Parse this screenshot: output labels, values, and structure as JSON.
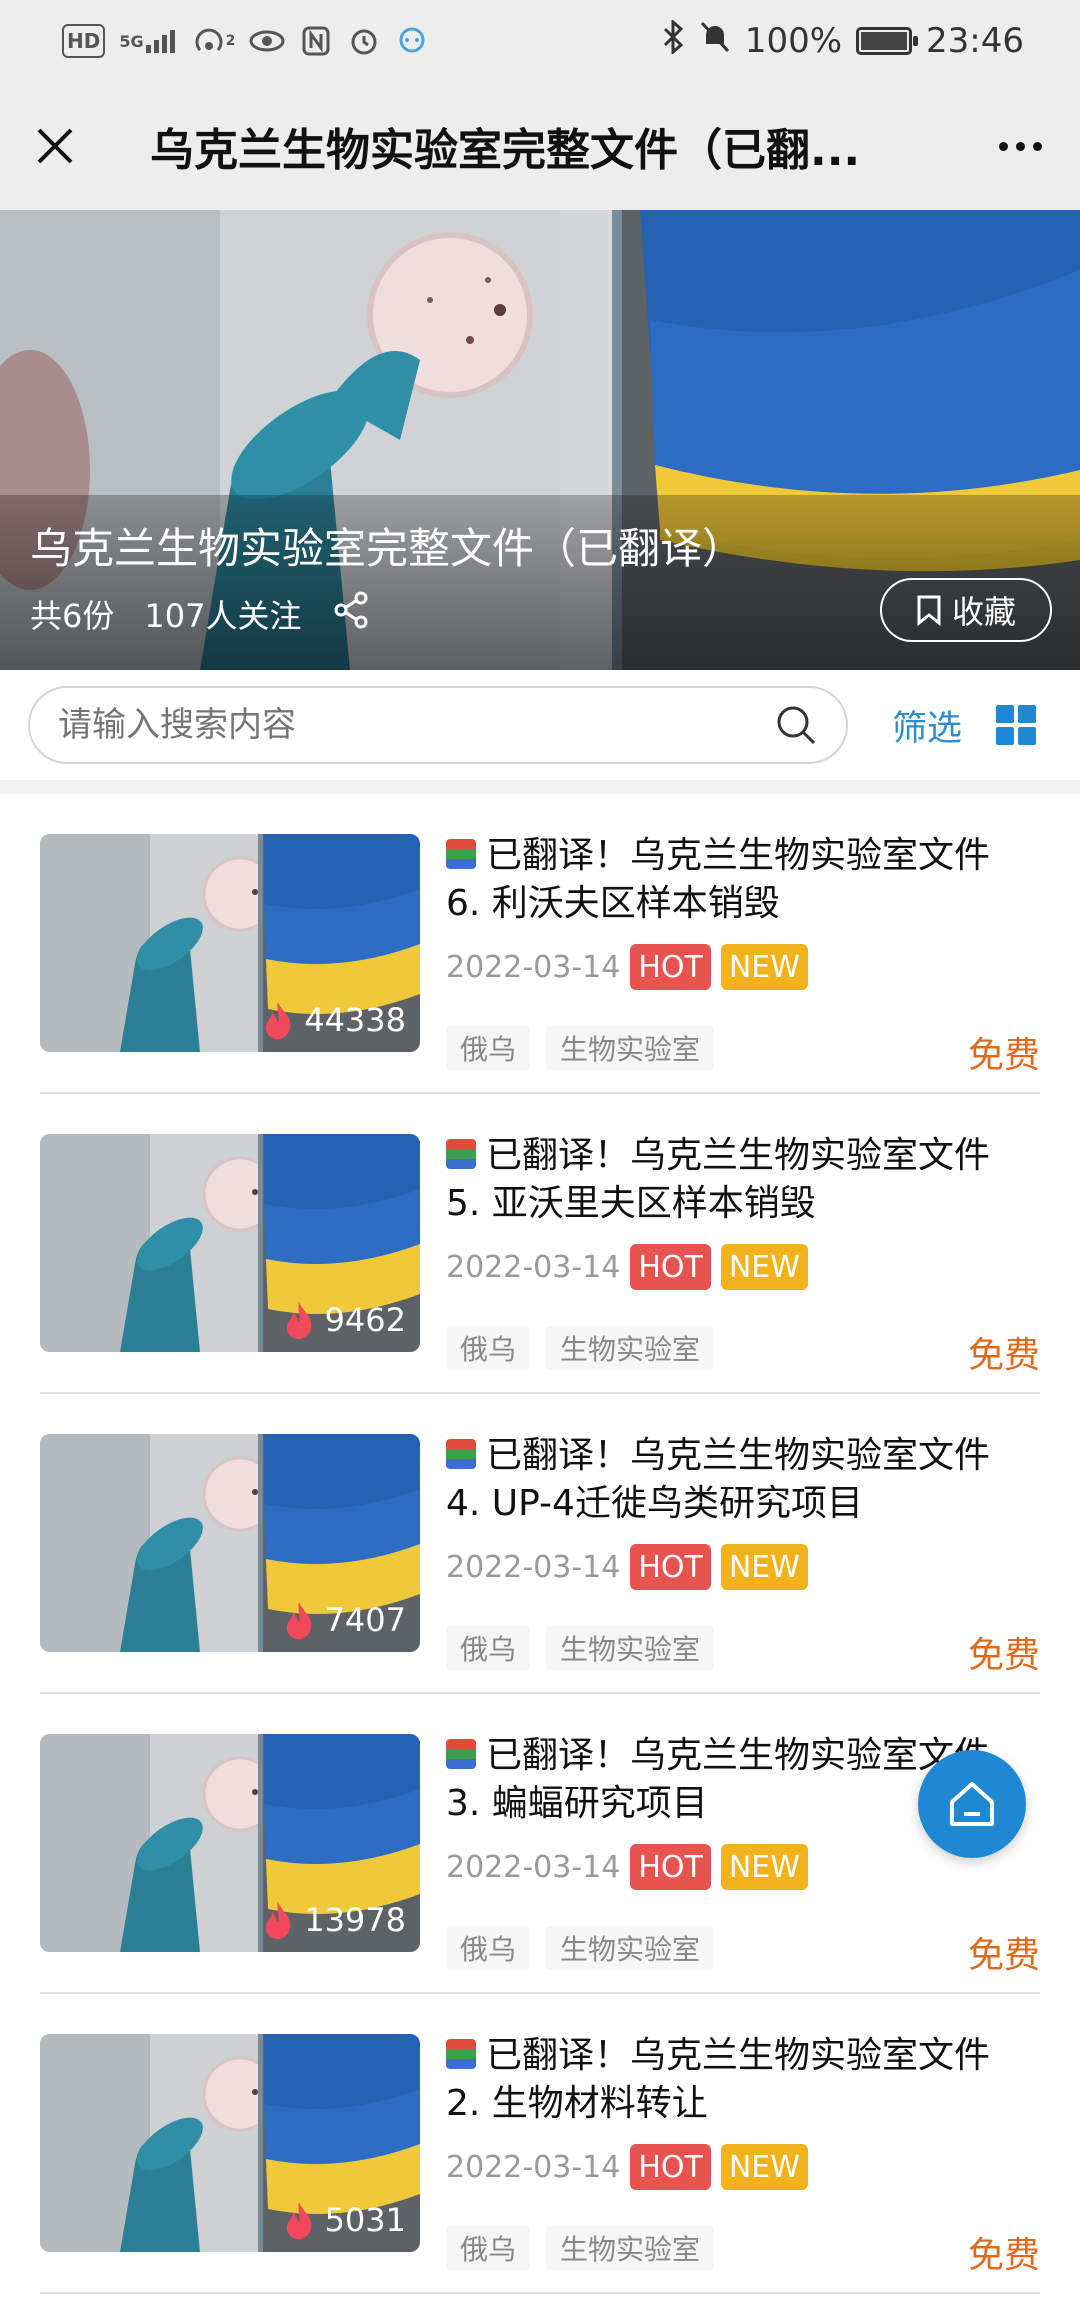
{
  "statusbar": {
    "left_icons": [
      "HD",
      "5G",
      "hotspot-icon",
      "eye-icon",
      "nfc-icon",
      "alarm-icon",
      "chat-icon"
    ],
    "hotspot_sup": "2",
    "battery": "100%",
    "time": "23:46"
  },
  "navbar": {
    "title": "乌克兰生物实验室完整文件（已翻..."
  },
  "hero": {
    "title": "乌克兰生物实验室完整文件（已翻译）",
    "count": "共6份",
    "followers": "107人关注",
    "favorite_label": "收藏"
  },
  "search": {
    "placeholder": "请输入搜索内容",
    "filter_label": "筛选"
  },
  "items": [
    {
      "line1": "已翻译！乌克兰生物实验室文件",
      "line2": "6. 利沃夫区样本销毁",
      "date": "2022-03-14",
      "hot": "HOT",
      "new": "NEW",
      "views": "44338",
      "tag1": "俄乌",
      "tag2": "生物实验室",
      "price": "免费"
    },
    {
      "line1": "已翻译！乌克兰生物实验室文件",
      "line2": "5. 亚沃里夫区样本销毁",
      "date": "2022-03-14",
      "hot": "HOT",
      "new": "NEW",
      "views": "9462",
      "tag1": "俄乌",
      "tag2": "生物实验室",
      "price": "免费"
    },
    {
      "line1": "已翻译！乌克兰生物实验室文件",
      "line2": "4. UP-4迁徙鸟类研究项目",
      "date": "2022-03-14",
      "hot": "HOT",
      "new": "NEW",
      "views": "7407",
      "tag1": "俄乌",
      "tag2": "生物实验室",
      "price": "免费"
    },
    {
      "line1": "已翻译！乌克兰生物实验室文件",
      "line2": "3. 蝙蝠研究项目",
      "date": "2022-03-14",
      "hot": "HOT",
      "new": "NEW",
      "views": "13978",
      "tag1": "俄乌",
      "tag2": "生物实验室",
      "price": "免费"
    },
    {
      "line1": "已翻译！乌克兰生物实验室文件",
      "line2": "2. 生物材料转让",
      "date": "2022-03-14",
      "hot": "HOT",
      "new": "NEW",
      "views": "5031",
      "tag1": "俄乌",
      "tag2": "生物实验室",
      "price": "免费"
    }
  ],
  "colors": {
    "accent": "#1e88d2",
    "hot": "#e9534f",
    "new": "#f2b21b",
    "price": "#e06a1b"
  }
}
